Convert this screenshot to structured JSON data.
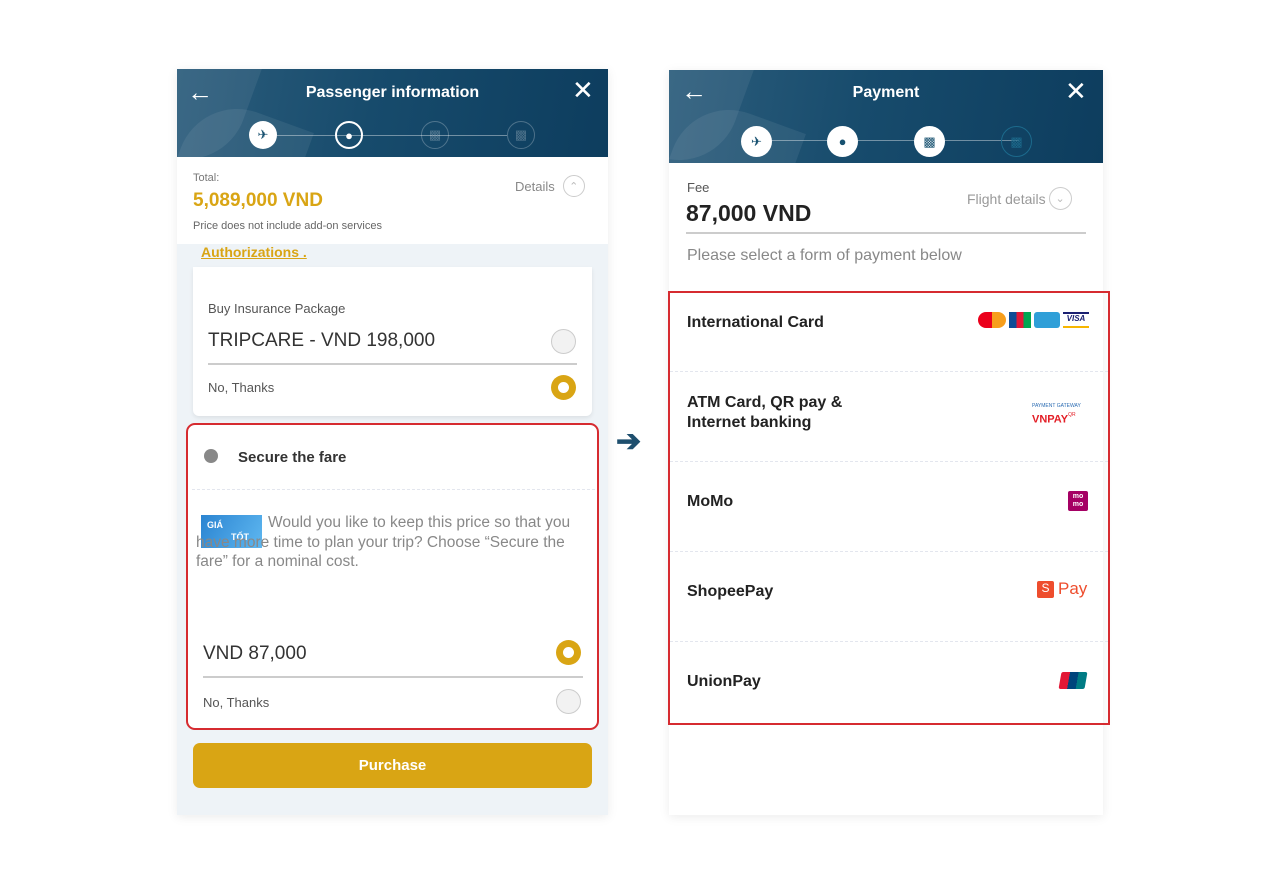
{
  "left": {
    "header": {
      "title": "Passenger information",
      "back_icon": "arrow-left-icon",
      "close_icon": "close-icon",
      "steps": [
        {
          "icon": "plane-icon",
          "state": "done"
        },
        {
          "icon": "passengers-icon",
          "state": "current"
        },
        {
          "icon": "luggage-icon",
          "state": "todo"
        },
        {
          "icon": "wallet-icon",
          "state": "todo"
        }
      ]
    },
    "total": {
      "label": "Total:",
      "amount": "5,089,000 VND",
      "note": "Price does not include add-on services",
      "details_label": "Details"
    },
    "authorizations_link": "Authorizations .",
    "insurance": {
      "label": "Buy Insurance Package",
      "option": "TRIPCARE - VND 198,000",
      "option_selected": false,
      "no_label": "No, Thanks",
      "no_selected": true
    },
    "secure": {
      "title": "Secure the fare",
      "image_text": [
        "GIÁ",
        "TỐT"
      ],
      "description": "Would you like to keep this price so that you have more time to plan your trip? Choose “Secure the fare” for a nominal cost.",
      "option": "VND 87,000",
      "option_selected": true,
      "no_label": "No, Thanks",
      "no_selected": false
    },
    "purchase_label": "Purchase"
  },
  "right": {
    "header": {
      "title": "Payment",
      "back_icon": "arrow-left-icon",
      "close_icon": "close-icon",
      "steps": [
        {
          "icon": "plane-icon",
          "state": "done"
        },
        {
          "icon": "passengers-icon",
          "state": "done"
        },
        {
          "icon": "luggage-icon",
          "state": "done"
        },
        {
          "icon": "wallet-icon",
          "state": "todo"
        }
      ]
    },
    "fee": {
      "label": "Fee",
      "amount": "87,000 VND",
      "flight_details_label": "Flight details"
    },
    "instruction": "Please select a form of payment below",
    "methods": [
      {
        "name": "International Card",
        "logos": [
          "MasterCard",
          "JCB",
          "AMERICAN EXPRESS",
          "VISA"
        ]
      },
      {
        "name": "ATM Card, QR pay & Internet banking",
        "logos": [
          "PAYMENT GATEWAY",
          "VNPAY",
          "QR"
        ]
      },
      {
        "name": "MoMo",
        "logos": [
          "mo mo"
        ]
      },
      {
        "name": "ShopeePay",
        "logos": [
          "S",
          "Pay"
        ]
      },
      {
        "name": "UnionPay",
        "logos": [
          "UnionPay"
        ]
      }
    ]
  },
  "colors": {
    "accent": "#d9a514",
    "header": "#174b6c",
    "highlight": "#d62b30"
  }
}
